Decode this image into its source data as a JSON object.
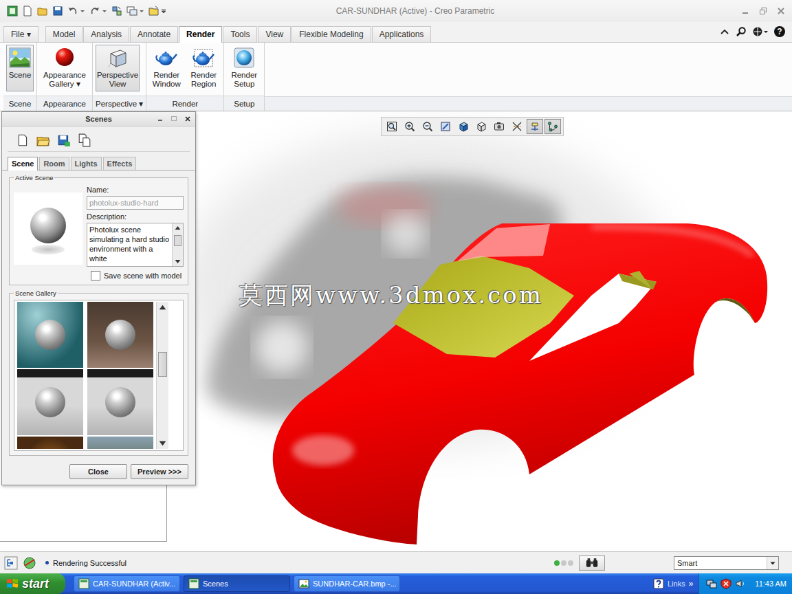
{
  "window": {
    "title": "CAR-SUNDHAR (Active) - Creo Parametric",
    "help": "?"
  },
  "tabs": [
    {
      "label": "File ▾",
      "selected": false
    },
    {
      "label": "Model",
      "selected": false
    },
    {
      "label": "Analysis",
      "selected": false
    },
    {
      "label": "Annotate",
      "selected": false
    },
    {
      "label": "Render",
      "selected": true
    },
    {
      "label": "Tools",
      "selected": false
    },
    {
      "label": "View",
      "selected": false
    },
    {
      "label": "Flexible Modeling",
      "selected": false
    },
    {
      "label": "Applications",
      "selected": false
    }
  ],
  "ribbon_groups": [
    {
      "label": "Scene",
      "buttons": [
        {
          "label": "Scene",
          "kind": "scene",
          "pressed": true
        }
      ]
    },
    {
      "label": "Appearance",
      "buttons": [
        {
          "label": "Appearance Gallery ▾",
          "kind": "appearance",
          "pressed": false
        }
      ]
    },
    {
      "label": "Perspective ▾",
      "buttons": [
        {
          "label": "Perspective View",
          "kind": "perspective",
          "pressed": true
        }
      ]
    },
    {
      "label": "Render",
      "buttons": [
        {
          "label": "Render Window",
          "kind": "render-window",
          "pressed": false
        },
        {
          "label": "Render Region",
          "kind": "render-region",
          "pressed": false
        }
      ]
    },
    {
      "label": "Setup",
      "buttons": [
        {
          "label": "Render Setup",
          "kind": "render-setup",
          "pressed": false
        }
      ]
    }
  ],
  "view_toolbar": [
    {
      "kind": "refit",
      "pressed": false
    },
    {
      "kind": "zoom-in",
      "pressed": false
    },
    {
      "kind": "zoom-out",
      "pressed": false
    },
    {
      "kind": "repaint",
      "pressed": false
    },
    {
      "kind": "display-style",
      "pressed": false
    },
    {
      "kind": "saved-views",
      "pressed": false
    },
    {
      "kind": "view-manager",
      "pressed": false
    },
    {
      "kind": "datum-display",
      "pressed": false
    },
    {
      "kind": "spin-center",
      "pressed": true
    },
    {
      "kind": "annotation-display",
      "pressed": true
    }
  ],
  "graphics": {
    "watermark": "莫西网www.3dmox.com"
  },
  "scenes_dialog": {
    "title": "Scenes",
    "tabs": [
      {
        "label": "Scene",
        "selected": true
      },
      {
        "label": "Room",
        "selected": false
      },
      {
        "label": "Lights",
        "selected": false
      },
      {
        "label": "Effects",
        "selected": false
      }
    ],
    "active_scene": {
      "legend": "Active Scene",
      "name_label": "Name:",
      "name": "photolux-studio-hard",
      "name_disabled": true,
      "description_label": "Description:",
      "description": "Photolux scene simulating a hard studio environment with a white",
      "save_with_model": {
        "label": "Save scene with model",
        "checked": false
      }
    },
    "gallery": {
      "legend": "Scene Gallery",
      "scroll_position": 0.4
    },
    "buttons": [
      "Close",
      "Preview >>>"
    ]
  },
  "status_bar": {
    "message": "Rendering Successful",
    "indicator": [
      {
        "color": "#3cb043"
      },
      {
        "color": "#c8c8c8"
      },
      {
        "color": "#c8c8c8"
      }
    ],
    "filter": "Smart"
  },
  "taskbar": {
    "start": "start",
    "tasks": [
      {
        "label": "CAR-SUNDHAR (Activ...",
        "selected": false
      },
      {
        "label": "Scenes",
        "selected": true
      },
      {
        "label": "SUNDHAR-CAR.bmp -...",
        "selected": false
      }
    ],
    "links": "Links",
    "links_arrow": "»",
    "time": "11:43 AM"
  }
}
